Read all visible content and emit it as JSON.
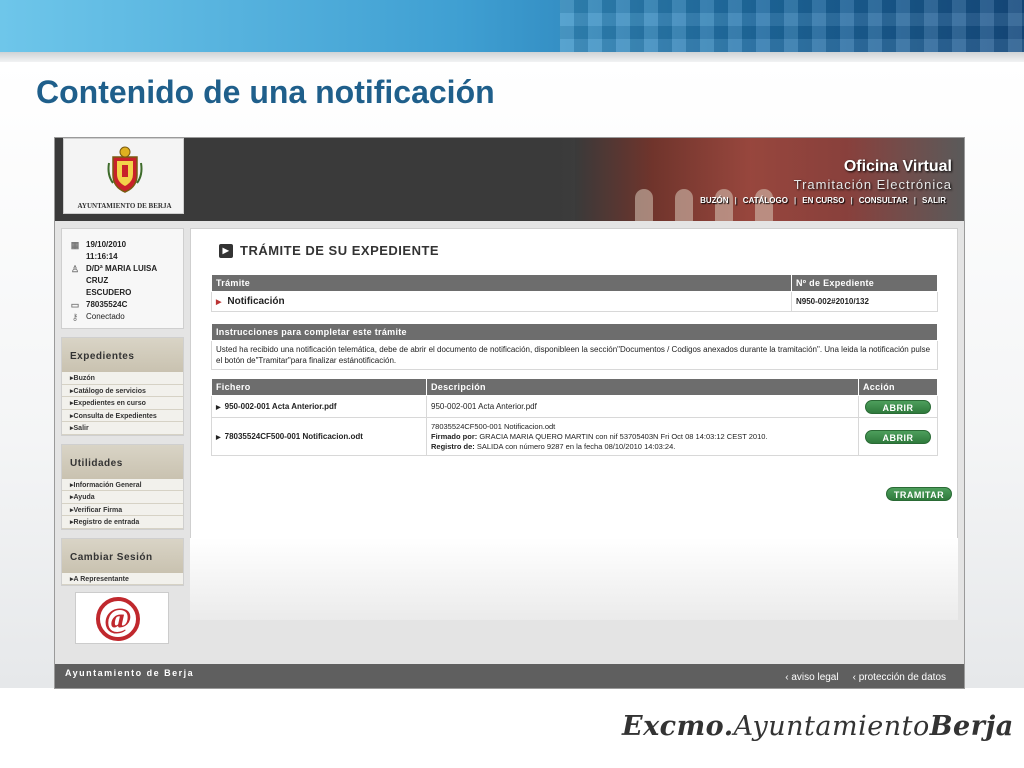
{
  "slide": {
    "title": "Contenido de una notificación",
    "signature": {
      "part1": "Excmo.",
      "part2": "Ayuntamiento",
      "part3": "Berja"
    }
  },
  "header": {
    "logo_text": "AYUNTAMIENTO DE BERJA",
    "office_title": "Oficina Virtual",
    "office_subtitle": "Tramitación Electrónica",
    "nav": [
      "BUZÓN",
      "CATÁLOGO",
      "EN CURSO",
      "CONSULTAR",
      "SALIR"
    ]
  },
  "user": {
    "date": "19/10/2010",
    "time": "11:16:14",
    "name_line1": "D/Dª MARIA LUISA",
    "name_line2": "CRUZ",
    "name_line3": "ESCUDERO",
    "nif": "78035524C",
    "status": "Conectado"
  },
  "sidebar": {
    "expedientes": {
      "title": "Expedientes",
      "items": [
        "Buzón",
        "Catálogo de servicios",
        "Expedientes en curso",
        "Consulta de Expedientes",
        "Salir"
      ]
    },
    "utilidades": {
      "title": "Utilidades",
      "items": [
        "Información General",
        "Ayuda",
        "Verificar Firma",
        "Registro de entrada"
      ]
    },
    "cambiar": {
      "title": "Cambiar Sesión",
      "items": [
        "A Representante"
      ]
    }
  },
  "main": {
    "section_title": "TRÁMITE DE SU EXPEDIENTE",
    "tramite_table": {
      "headers": [
        "Trámite",
        "Nº de Expediente"
      ],
      "row": {
        "tramite": "Notificación",
        "expediente": "N950-002#2010/132"
      }
    },
    "instrucciones": {
      "header": "Instrucciones para completar este trámite",
      "text": "Usted ha recibido una notificación telemática, debe de abrir el documento de notificación, disponibleen la sección\"Documentos / Codigos anexados durante la tramitación\". Una leida la notificación pulse el botón de\"Tramitar\"para finalizar estánotificación."
    },
    "ficheros": {
      "headers": [
        "Fichero",
        "Descripción",
        "Acción"
      ],
      "rows": [
        {
          "fichero": "950-002-001 Acta Anterior.pdf",
          "descripcion": "950-002-001 Acta Anterior.pdf",
          "accion": "ABRIR"
        },
        {
          "fichero": "78035524CF500-001 Notificacion.odt",
          "descripcion": "78035524CF500-001 Notificacion.odt",
          "firmado_label": "Firmado por:",
          "firmado_text": "GRACIA MARIA QUERO MARTIN con nif 53705403N Fri Oct 08 14:03:12 CEST 2010.",
          "registro_label": "Registro de:",
          "registro_text": "SALIDA con número 9287 en la fecha 08/10/2010 14:03:24.",
          "accion": "ABRIR"
        }
      ]
    },
    "tramitar_label": "TRAMITAR"
  },
  "footer": {
    "left": "Ayuntamiento de Berja",
    "links": [
      "aviso legal",
      "protección de datos"
    ]
  }
}
